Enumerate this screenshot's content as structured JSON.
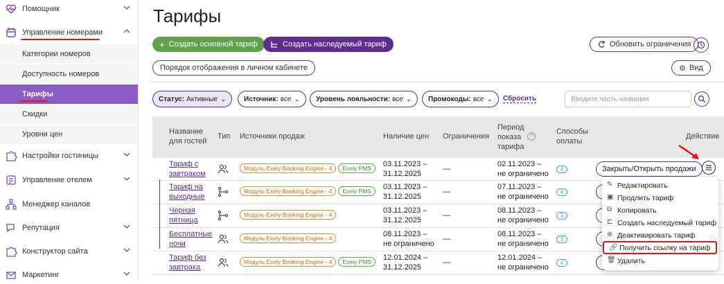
{
  "sidebar": {
    "items": [
      {
        "label": "Помощник",
        "icon": "heart-pulse-icon"
      },
      {
        "label": "Управление номерами",
        "icon": "calendar-icon"
      },
      {
        "label": "Настройки гостиницы",
        "icon": "puzzle-icon"
      },
      {
        "label": "Управление отелем",
        "icon": "list-icon"
      },
      {
        "label": "Менеджер каналов",
        "icon": "sitemap-icon"
      },
      {
        "label": "Репутация",
        "icon": "chat-icon"
      },
      {
        "label": "Конструктор сайта",
        "icon": "puzzle-icon"
      },
      {
        "label": "Маркетинг",
        "icon": "envelope-icon"
      }
    ],
    "subitems": [
      "Категории номеров",
      "Доступность номеров",
      "Тарифы",
      "Скидки",
      "Уровни цен"
    ]
  },
  "page": {
    "title": "Тарифы"
  },
  "toolbar": {
    "create_base": "Создать основной тариф",
    "create_inherited": "Создать наследуемый тариф",
    "update_restrictions": "Обновить ограничения",
    "display_order": "Порядок отображения в личном кабинете",
    "view": "Вид"
  },
  "filters": {
    "status_label": "Статус:",
    "status_value": "Активные",
    "source_label": "Источник:",
    "source_value": "все",
    "loyalty_label": "Уровень лояльности:",
    "loyalty_value": "все",
    "promo_label": "Промокоды:",
    "promo_value": "все",
    "reset": "Сбросить",
    "search_placeholder": "Введите часть названия"
  },
  "table": {
    "headers": {
      "name": "Название для гостей",
      "type": "Тип",
      "sources": "Источники продаж",
      "prices": "Наличие цен",
      "restrictions": "Ограничения",
      "period": "Период показа тарифа",
      "payment": "Способы оплаты",
      "action": "Действие"
    },
    "rows": [
      {
        "name1": "Тариф с",
        "name2": "завтраком",
        "src1": "Модуль Exely Booking Engine - 4",
        "src2": "Exely PMS",
        "prices1": "03.11.2023 –",
        "prices2": "31.12.2025",
        "restr": "—",
        "period1": "02.11.2023 –",
        "period2": "не ограничено",
        "pay": "4",
        "action": "Закрыть/Открыть продажи"
      },
      {
        "name1": "Тариф на",
        "name2": "выходные",
        "src1": "Модуль Exely Booking Engine - 4",
        "src2": "Exely PMS",
        "prices1": "03.11.2023 –",
        "prices2": "31.12.2025",
        "restr": "—",
        "period1": "07.11.2023 –",
        "period2": "не ограничено",
        "pay": "4",
        "action": ""
      },
      {
        "name1": "Черная",
        "name2": "пятница",
        "src1": "Модуль Exely Booking Engine - 4",
        "src2": "",
        "prices1": "03.11.2023 –",
        "prices2": "31.12.2025",
        "restr": "—",
        "period1": "08.11.2023 –",
        "period2": "не ограничено",
        "pay": "3",
        "action": ""
      },
      {
        "name1": "Бесплатные",
        "name2": "ночи",
        "src1": "Модуль Exely Booking Engine - 4",
        "src2": "",
        "prices1": "08.11.2023 –",
        "prices2": "не ограничено",
        "restr": "—",
        "period1": "08.11.2023 –",
        "period2": "не ограничено",
        "pay": "3",
        "action": ""
      },
      {
        "name1": "Тариф без",
        "name2": "завтрака",
        "src1": "Модуль Exely Booking Engine - 4",
        "src2": "Exely PMS",
        "prices1": "12.01.2024 –",
        "prices2": "31.12.2025",
        "restr": "—",
        "period1": "12.01.2024 –",
        "period2": "не ограничено",
        "pay": "4",
        "action": ""
      }
    ]
  },
  "action_menu": {
    "items": [
      "Редактировать",
      "Продлить тариф",
      "Копировать",
      "Создать наследуемый тариф",
      "Деактивировать тариф",
      "Получить ссылку на тариф",
      "Удалить"
    ]
  },
  "colors": {
    "accent": "#5b2d8f",
    "active_sidebar": "#8b5cc4",
    "green": "#5fa24a",
    "highlight": "#e11111"
  }
}
